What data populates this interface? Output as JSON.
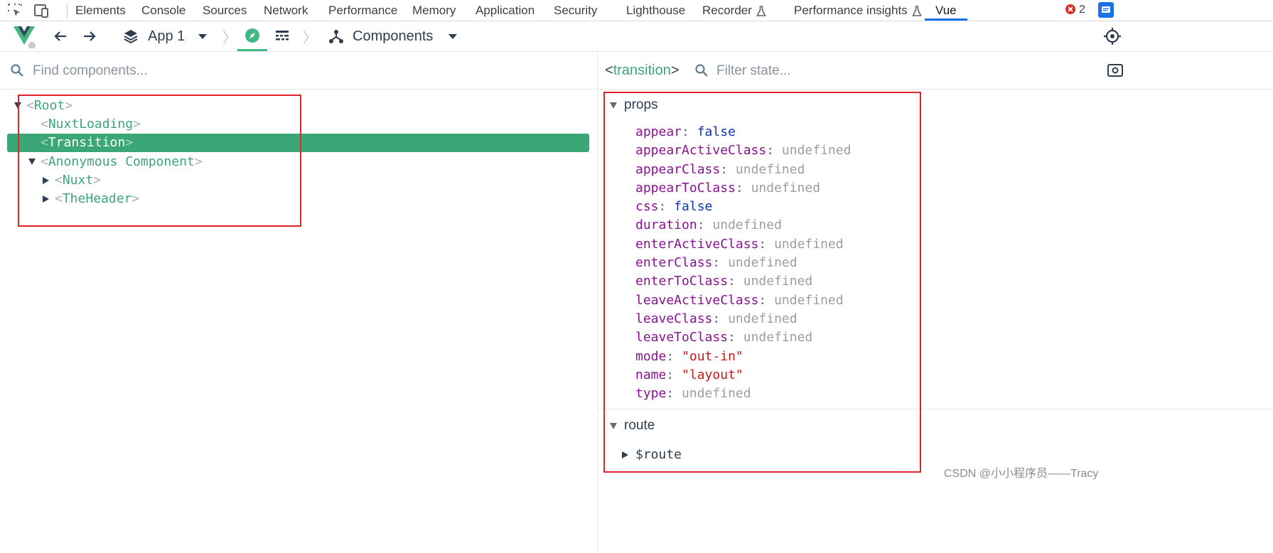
{
  "devtools": {
    "tabs": [
      {
        "label": "Elements",
        "active": false
      },
      {
        "label": "Console",
        "active": false
      },
      {
        "label": "Sources",
        "active": false
      },
      {
        "label": "Network",
        "active": false
      },
      {
        "label": "Performance",
        "active": false
      },
      {
        "label": "Memory",
        "active": false
      },
      {
        "label": "Application",
        "active": false
      },
      {
        "label": "Security",
        "active": false
      },
      {
        "label": "Lighthouse",
        "active": false
      },
      {
        "label": "Recorder",
        "active": false,
        "icon": "flask-icon"
      },
      {
        "label": "Performance insights",
        "active": false,
        "icon": "flask-icon"
      },
      {
        "label": "Vue",
        "active": true
      }
    ],
    "error_count": "2",
    "accent_color": "#1a73e8",
    "error_color": "#d93025"
  },
  "vue_toolbar": {
    "app_selector_label": "App 1",
    "inspector_label": "Components",
    "accent_color": "#42b883"
  },
  "left_pane": {
    "search_placeholder": "Find components...",
    "tree": [
      {
        "name": "Root",
        "depth": 0,
        "arrow": "expanded",
        "selected": false
      },
      {
        "name": "NuxtLoading",
        "depth": 1,
        "arrow": "none",
        "selected": false
      },
      {
        "name": "Transition",
        "depth": 1,
        "arrow": "none",
        "selected": true
      },
      {
        "name": "Anonymous Component",
        "depth": 1,
        "arrow": "expanded",
        "selected": false
      },
      {
        "name": "Nuxt",
        "depth": 2,
        "arrow": "collapsed",
        "selected": false
      },
      {
        "name": "TheHeader",
        "depth": 2,
        "arrow": "collapsed",
        "selected": false
      }
    ]
  },
  "right_pane": {
    "selected_component": "transition",
    "filter_placeholder": "Filter state...",
    "props_section_label": "props",
    "props": [
      {
        "key": "appear",
        "value": "false",
        "kind": "bool"
      },
      {
        "key": "appearActiveClass",
        "value": "undefined",
        "kind": "undef"
      },
      {
        "key": "appearClass",
        "value": "undefined",
        "kind": "undef"
      },
      {
        "key": "appearToClass",
        "value": "undefined",
        "kind": "undef"
      },
      {
        "key": "css",
        "value": "false",
        "kind": "bool"
      },
      {
        "key": "duration",
        "value": "undefined",
        "kind": "undef"
      },
      {
        "key": "enterActiveClass",
        "value": "undefined",
        "kind": "undef"
      },
      {
        "key": "enterClass",
        "value": "undefined",
        "kind": "undef"
      },
      {
        "key": "enterToClass",
        "value": "undefined",
        "kind": "undef"
      },
      {
        "key": "leaveActiveClass",
        "value": "undefined",
        "kind": "undef"
      },
      {
        "key": "leaveClass",
        "value": "undefined",
        "kind": "undef"
      },
      {
        "key": "leaveToClass",
        "value": "undefined",
        "kind": "undef"
      },
      {
        "key": "mode",
        "value": "\"out-in\"",
        "kind": "str"
      },
      {
        "key": "name",
        "value": "\"layout\"",
        "kind": "str"
      },
      {
        "key": "type",
        "value": "undefined",
        "kind": "undef"
      }
    ],
    "route_section_label": "route",
    "route_item": "$route"
  },
  "annotation_color": "#e3232b",
  "watermark": "CSDN @小小程序员——Tracy"
}
